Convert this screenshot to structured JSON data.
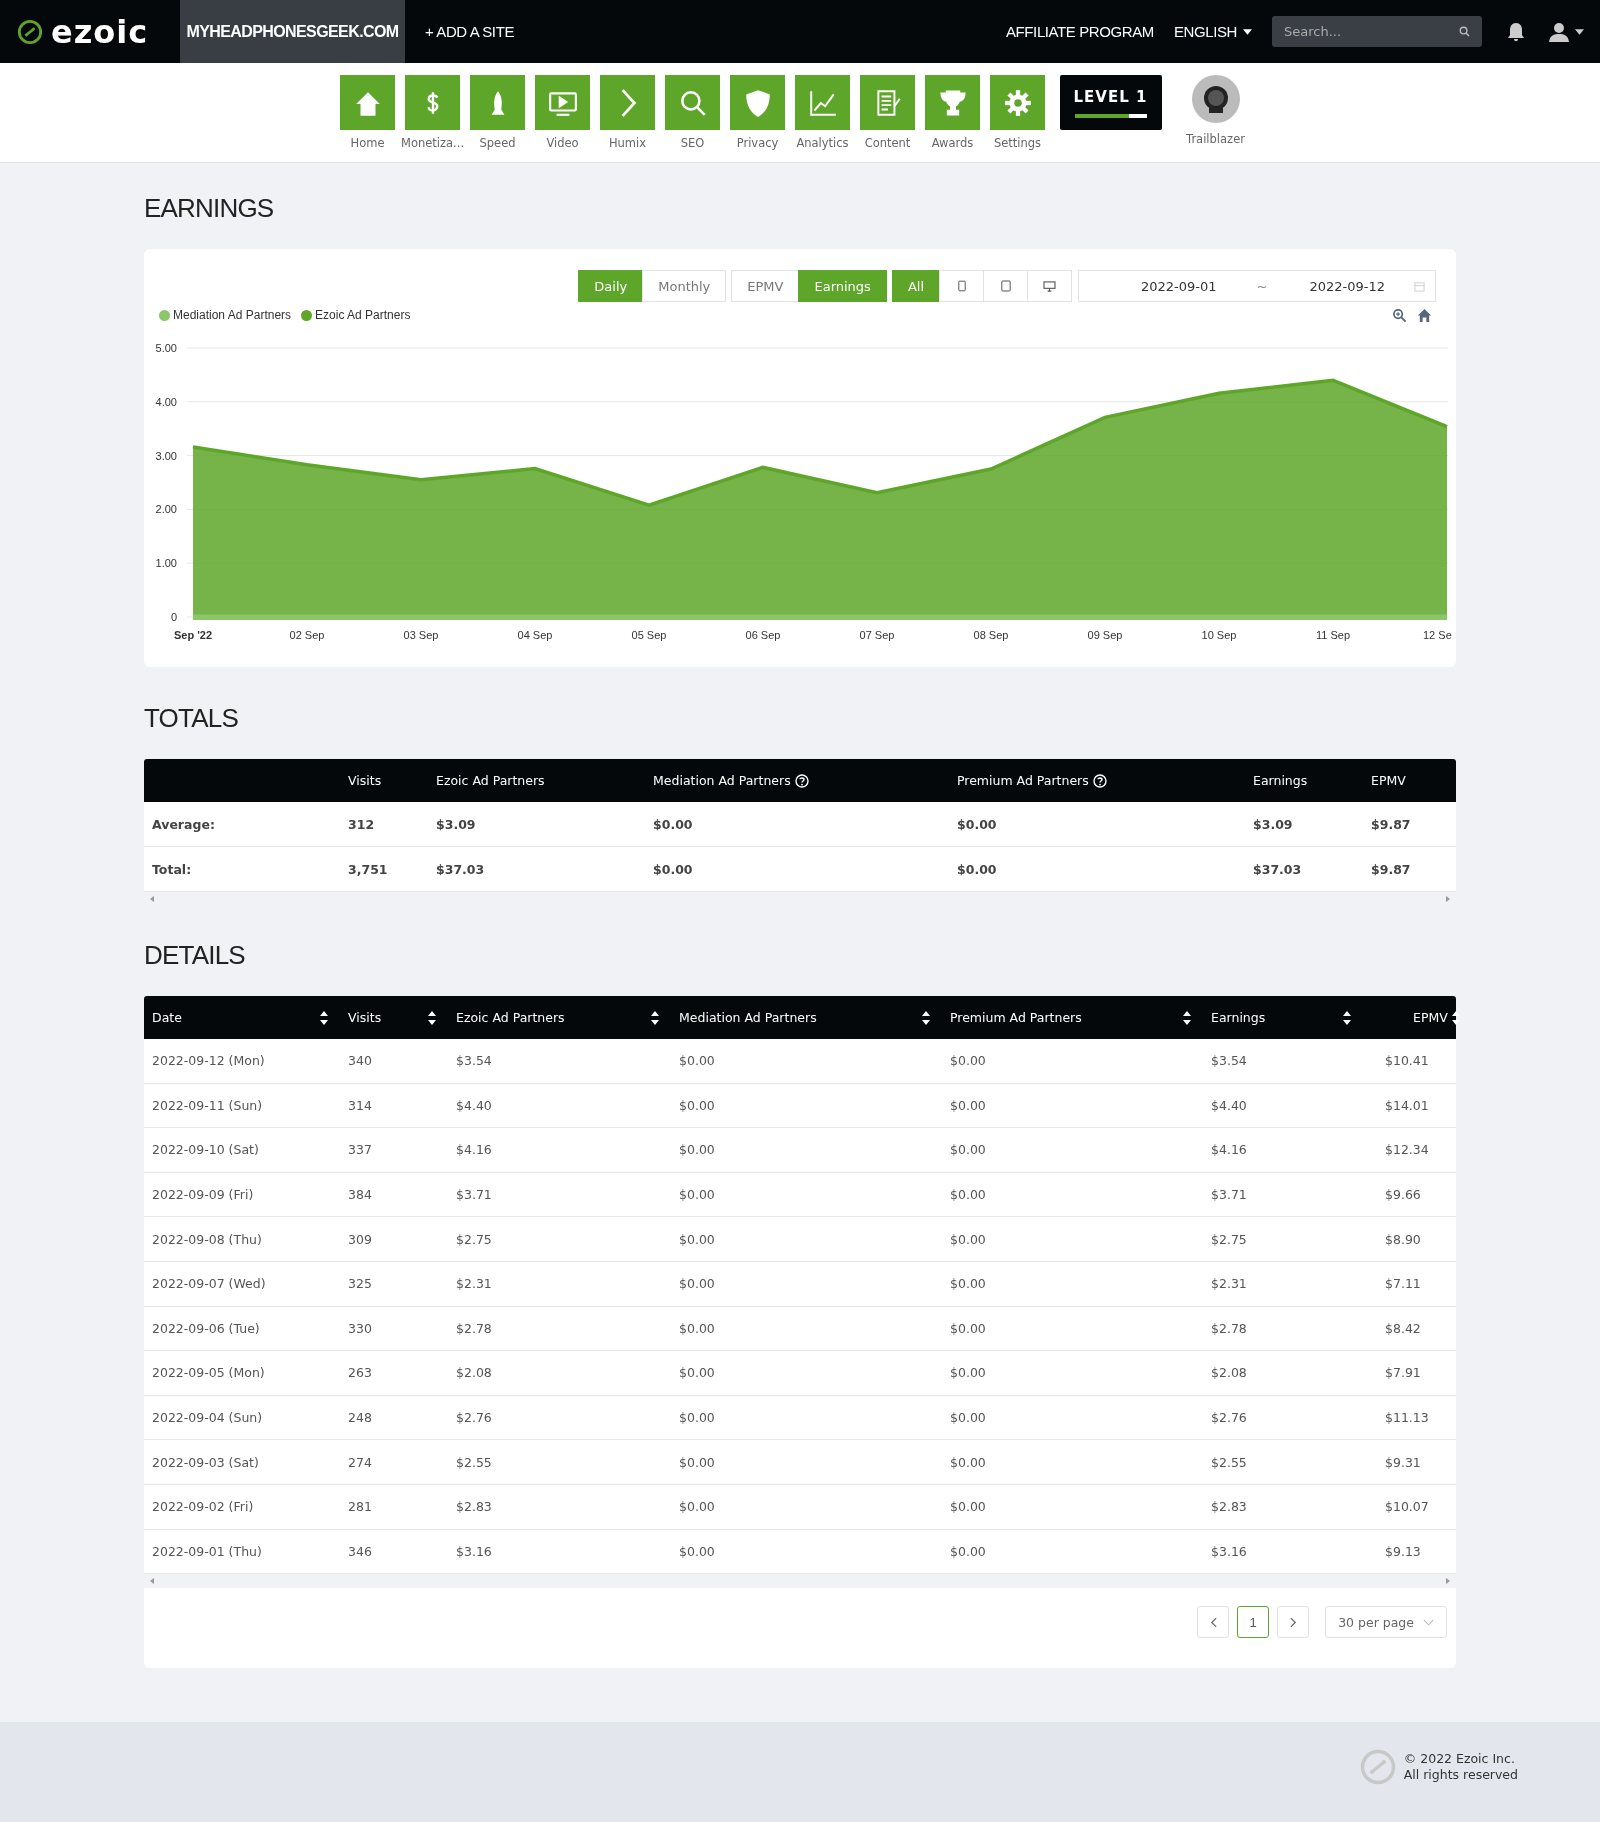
{
  "topbar": {
    "logo": "ezoic",
    "site": "MYHEADPHONESGEEK.COM",
    "add_site": "+ ADD A SITE",
    "affiliate": "AFFILIATE PROGRAM",
    "language": "ENGLISH",
    "search": {
      "placeholder": "Search..."
    }
  },
  "nav": [
    {
      "label": "Home",
      "kind": "home"
    },
    {
      "label": "Monetiza...",
      "kind": "dollar"
    },
    {
      "label": "Speed",
      "kind": "rocket"
    },
    {
      "label": "Video",
      "kind": "video"
    },
    {
      "label": "Humix",
      "kind": "chevron"
    },
    {
      "label": "SEO",
      "kind": "magnifier"
    },
    {
      "label": "Privacy",
      "kind": "shield"
    },
    {
      "label": "Analytics",
      "kind": "graph"
    },
    {
      "label": "Content",
      "kind": "document"
    },
    {
      "label": "Awards",
      "kind": "trophy"
    },
    {
      "label": "Settings",
      "kind": "gear"
    }
  ],
  "level_badge": {
    "text": "LEVEL 1",
    "level": 0.75
  },
  "profile": {
    "label": "Trailblazer"
  },
  "earnings": {
    "title": "EARNINGS",
    "period_tabs": [
      {
        "label": "Daily",
        "selected": true
      },
      {
        "label": "Monthly",
        "selected": false
      }
    ],
    "metric_tabs": [
      {
        "label": "EPMV",
        "selected": false
      },
      {
        "label": "Earnings",
        "selected": true
      }
    ],
    "device_tabs": [
      {
        "kind": "text",
        "label": "All",
        "selected": true
      },
      {
        "kind": "phone",
        "selected": false
      },
      {
        "kind": "tablet",
        "selected": false
      },
      {
        "kind": "desktop",
        "selected": false
      }
    ],
    "date_range": {
      "start": "2022-09-01",
      "separator": "~",
      "end": "2022-09-12"
    },
    "chart_data": {
      "type": "area",
      "categories": [
        "Sep '22",
        "02 Sep",
        "03 Sep",
        "04 Sep",
        "05 Sep",
        "06 Sep",
        "07 Sep",
        "08 Sep",
        "09 Sep",
        "10 Sep",
        "11 Sep",
        "12 Se"
      ],
      "series": [
        {
          "name": "Mediation Ad Partners",
          "color": "#8cc66a",
          "values": [
            0,
            0,
            0,
            0,
            0,
            0,
            0,
            0,
            0,
            0,
            0,
            0
          ]
        },
        {
          "name": "Ezoic Ad Partners",
          "color": "#5ea629",
          "values": [
            3.16,
            2.83,
            2.55,
            2.76,
            2.08,
            2.78,
            2.31,
            2.75,
            3.71,
            4.16,
            4.4,
            3.54
          ]
        }
      ],
      "grid": true,
      "ylim": [
        0,
        5
      ],
      "yticks": [
        {
          "value": 0,
          "label": "0"
        },
        {
          "value": 1,
          "label": "1.00"
        },
        {
          "value": 2,
          "label": "2.00"
        },
        {
          "value": 3,
          "label": "3.00"
        },
        {
          "value": 4,
          "label": "4.00"
        },
        {
          "value": 5,
          "label": "5.00"
        }
      ]
    }
  },
  "totals": {
    "title": "TOTALS",
    "columns": [
      {},
      {
        "label": "Visits"
      },
      {
        "label": "Ezoic Ad Partners"
      },
      {
        "label": "Mediation Ad Partners",
        "help": true
      },
      {
        "label": "Premium Ad Partners",
        "help": true
      },
      {
        "label": "Earnings"
      },
      {
        "label": "EPMV"
      }
    ],
    "rows": [
      [
        "Average:",
        "312",
        "$3.09",
        "$0.00",
        "$0.00",
        "$3.09",
        "$9.87"
      ],
      [
        "Total:",
        "3,751",
        "$37.03",
        "$0.00",
        "$0.00",
        "$37.03",
        "$9.87"
      ]
    ]
  },
  "details": {
    "title": "DETAILS",
    "columns": [
      "Date",
      "Visits",
      "Ezoic Ad Partners",
      "Mediation Ad Partners",
      "Premium Ad Partners",
      "Earnings",
      "EPMV"
    ],
    "rows": [
      [
        "2022-09-12 (Mon)",
        "340",
        "$3.54",
        "$0.00",
        "$0.00",
        "$3.54",
        "$10.41"
      ],
      [
        "2022-09-11 (Sun)",
        "314",
        "$4.40",
        "$0.00",
        "$0.00",
        "$4.40",
        "$14.01"
      ],
      [
        "2022-09-10 (Sat)",
        "337",
        "$4.16",
        "$0.00",
        "$0.00",
        "$4.16",
        "$12.34"
      ],
      [
        "2022-09-09 (Fri)",
        "384",
        "$3.71",
        "$0.00",
        "$0.00",
        "$3.71",
        "$9.66"
      ],
      [
        "2022-09-08 (Thu)",
        "309",
        "$2.75",
        "$0.00",
        "$0.00",
        "$2.75",
        "$8.90"
      ],
      [
        "2022-09-07 (Wed)",
        "325",
        "$2.31",
        "$0.00",
        "$0.00",
        "$2.31",
        "$7.11"
      ],
      [
        "2022-09-06 (Tue)",
        "330",
        "$2.78",
        "$0.00",
        "$0.00",
        "$2.78",
        "$8.42"
      ],
      [
        "2022-09-05 (Mon)",
        "263",
        "$2.08",
        "$0.00",
        "$0.00",
        "$2.08",
        "$7.91"
      ],
      [
        "2022-09-04 (Sun)",
        "248",
        "$2.76",
        "$0.00",
        "$0.00",
        "$2.76",
        "$11.13"
      ],
      [
        "2022-09-03 (Sat)",
        "274",
        "$2.55",
        "$0.00",
        "$0.00",
        "$2.55",
        "$9.31"
      ],
      [
        "2022-09-02 (Fri)",
        "281",
        "$2.83",
        "$0.00",
        "$0.00",
        "$2.83",
        "$10.07"
      ],
      [
        "2022-09-01 (Thu)",
        "346",
        "$3.16",
        "$0.00",
        "$0.00",
        "$3.16",
        "$9.13"
      ]
    ],
    "pages": [
      {
        "label": "1",
        "selected": true
      }
    ],
    "per_page": "30 per page"
  },
  "footer": {
    "copyright": "© 2022 Ezoic Inc.",
    "rights": "All rights reserved"
  }
}
